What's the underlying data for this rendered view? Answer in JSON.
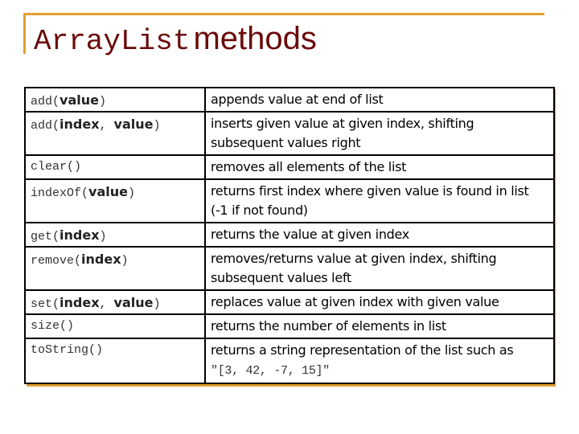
{
  "title": {
    "mono": "ArrayList",
    "sans": "methods"
  },
  "colors": {
    "accent": "#e0a030",
    "title": "#6b0a0a"
  },
  "methods": [
    {
      "name": "add(",
      "params": [
        [
          "value",
          ""
        ]
      ],
      "close": ")",
      "desc": "appends value at end of list"
    },
    {
      "name": "add(",
      "params": [
        [
          "index",
          ", "
        ],
        [
          "value",
          ""
        ]
      ],
      "close": ")",
      "desc": "inserts given value at given index, shifting subsequent values right"
    },
    {
      "name": "clear()",
      "params": [],
      "close": "",
      "desc": "removes all elements of the list"
    },
    {
      "name": "indexOf(",
      "params": [
        [
          "value",
          ""
        ]
      ],
      "close": ")",
      "desc": "returns first index where given value is found in list (-1 if not found)"
    },
    {
      "name": "get(",
      "params": [
        [
          "index",
          ""
        ]
      ],
      "close": ")",
      "desc": "returns the value at given index"
    },
    {
      "name": "remove(",
      "params": [
        [
          "index",
          ""
        ]
      ],
      "close": ")",
      "desc": "removes/returns value at given index, shifting subsequent values left"
    },
    {
      "name": "set(",
      "params": [
        [
          "index",
          ", "
        ],
        [
          "value",
          ""
        ]
      ],
      "close": ")",
      "desc": "replaces value at given index with given value"
    },
    {
      "name": "size()",
      "params": [],
      "close": "",
      "desc": "returns the number of elements in list"
    },
    {
      "name": "toString()",
      "params": [],
      "close": "",
      "desc": "returns a string representation of the list such as ",
      "code": "\"[3, 42, -7, 15]\""
    }
  ]
}
